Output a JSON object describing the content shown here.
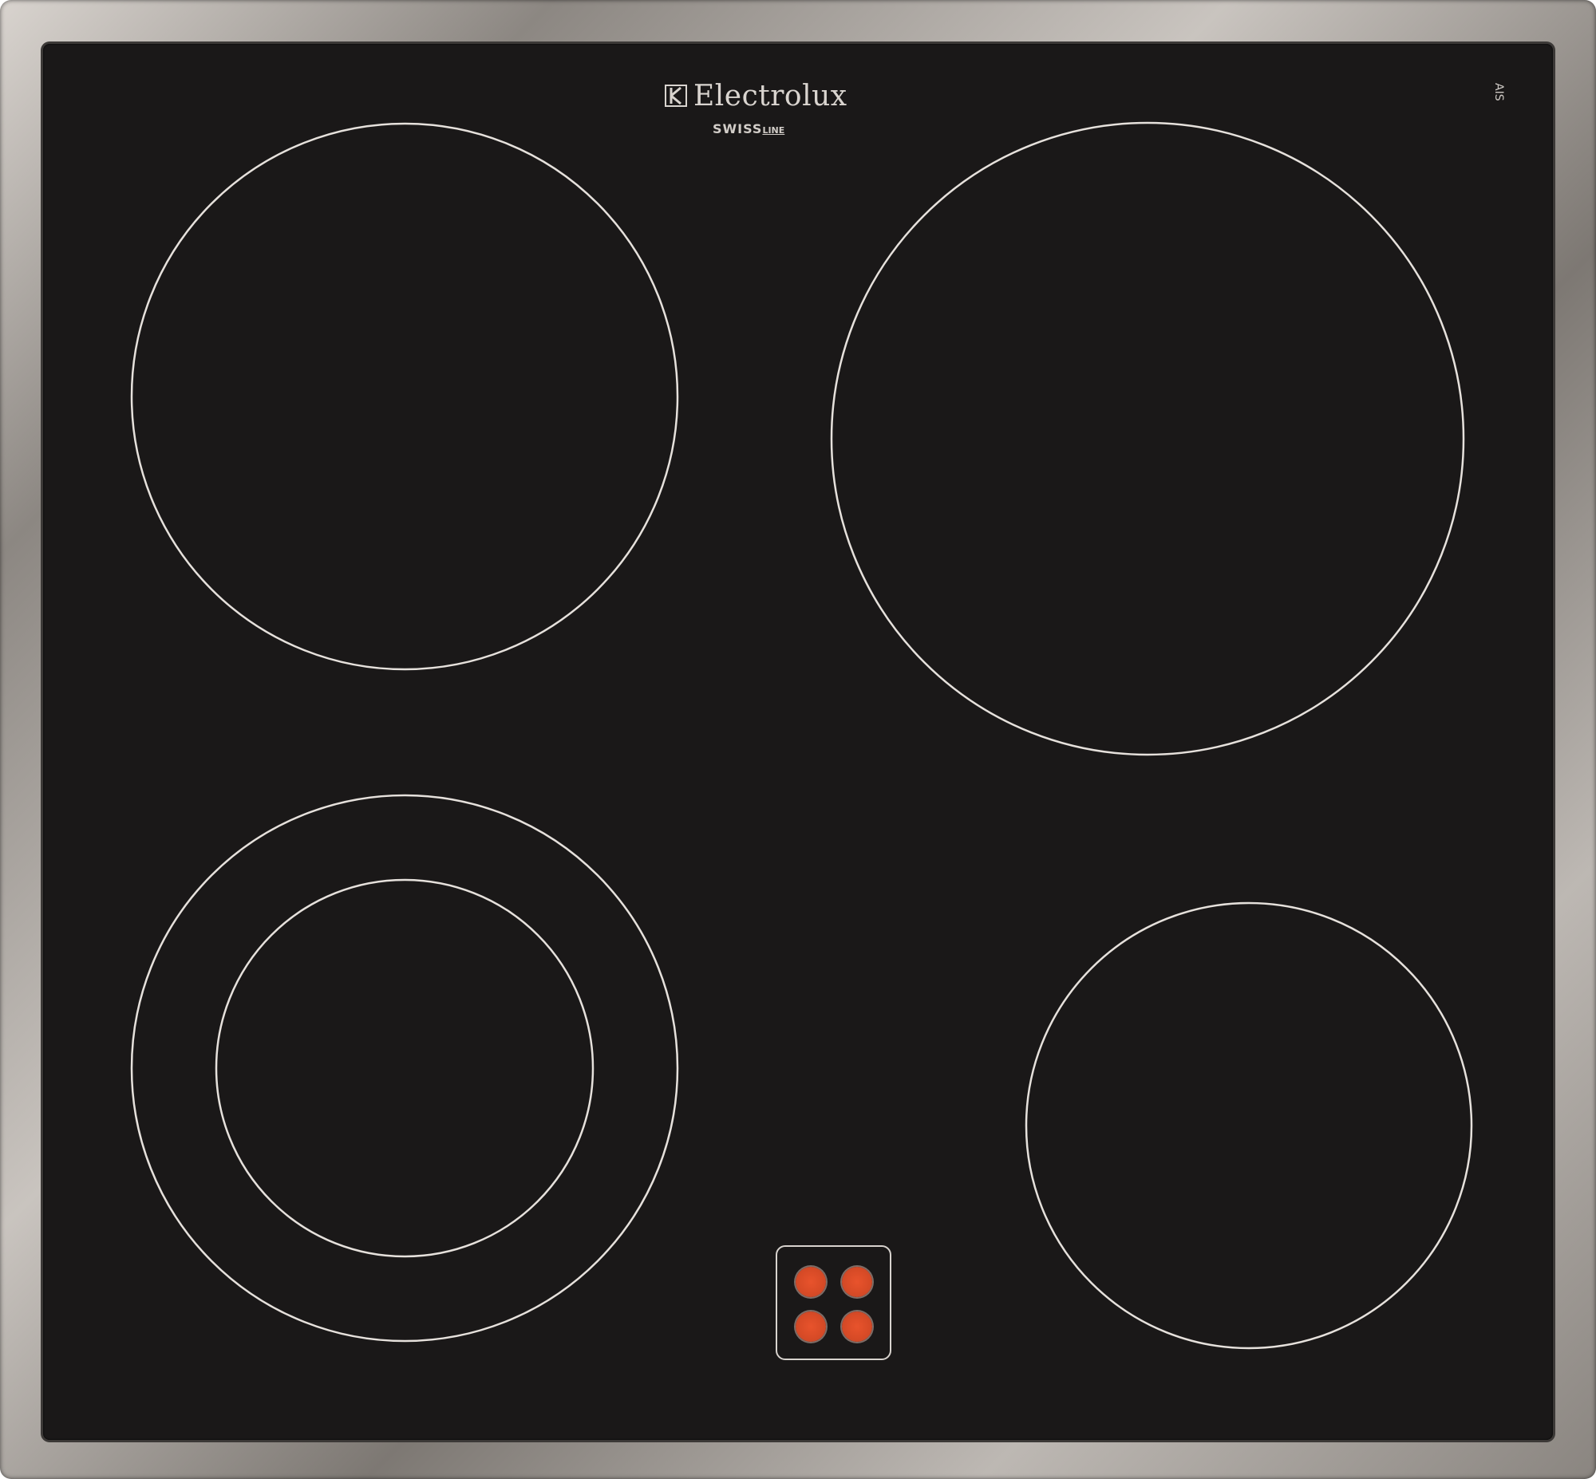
{
  "brand": {
    "name": "Electrolux",
    "logo_icon": "electrolux-logo-icon",
    "sub_brand_main": "SWISS",
    "sub_brand_line": "LINE"
  },
  "certification": {
    "mark_text": "AIS",
    "icon": "certification-mark-icon"
  },
  "cooktop": {
    "glass_color": "#1a1818",
    "frame_color": "#a9a49f",
    "zone_outline_color": "#e6e1dc",
    "indicator_color": "#e0502a",
    "zones": [
      {
        "name": "rear-left",
        "rings": 1
      },
      {
        "name": "rear-right",
        "rings": 1
      },
      {
        "name": "front-left",
        "rings": 2
      },
      {
        "name": "front-right",
        "rings": 1
      }
    ],
    "indicator_lights": 4
  }
}
